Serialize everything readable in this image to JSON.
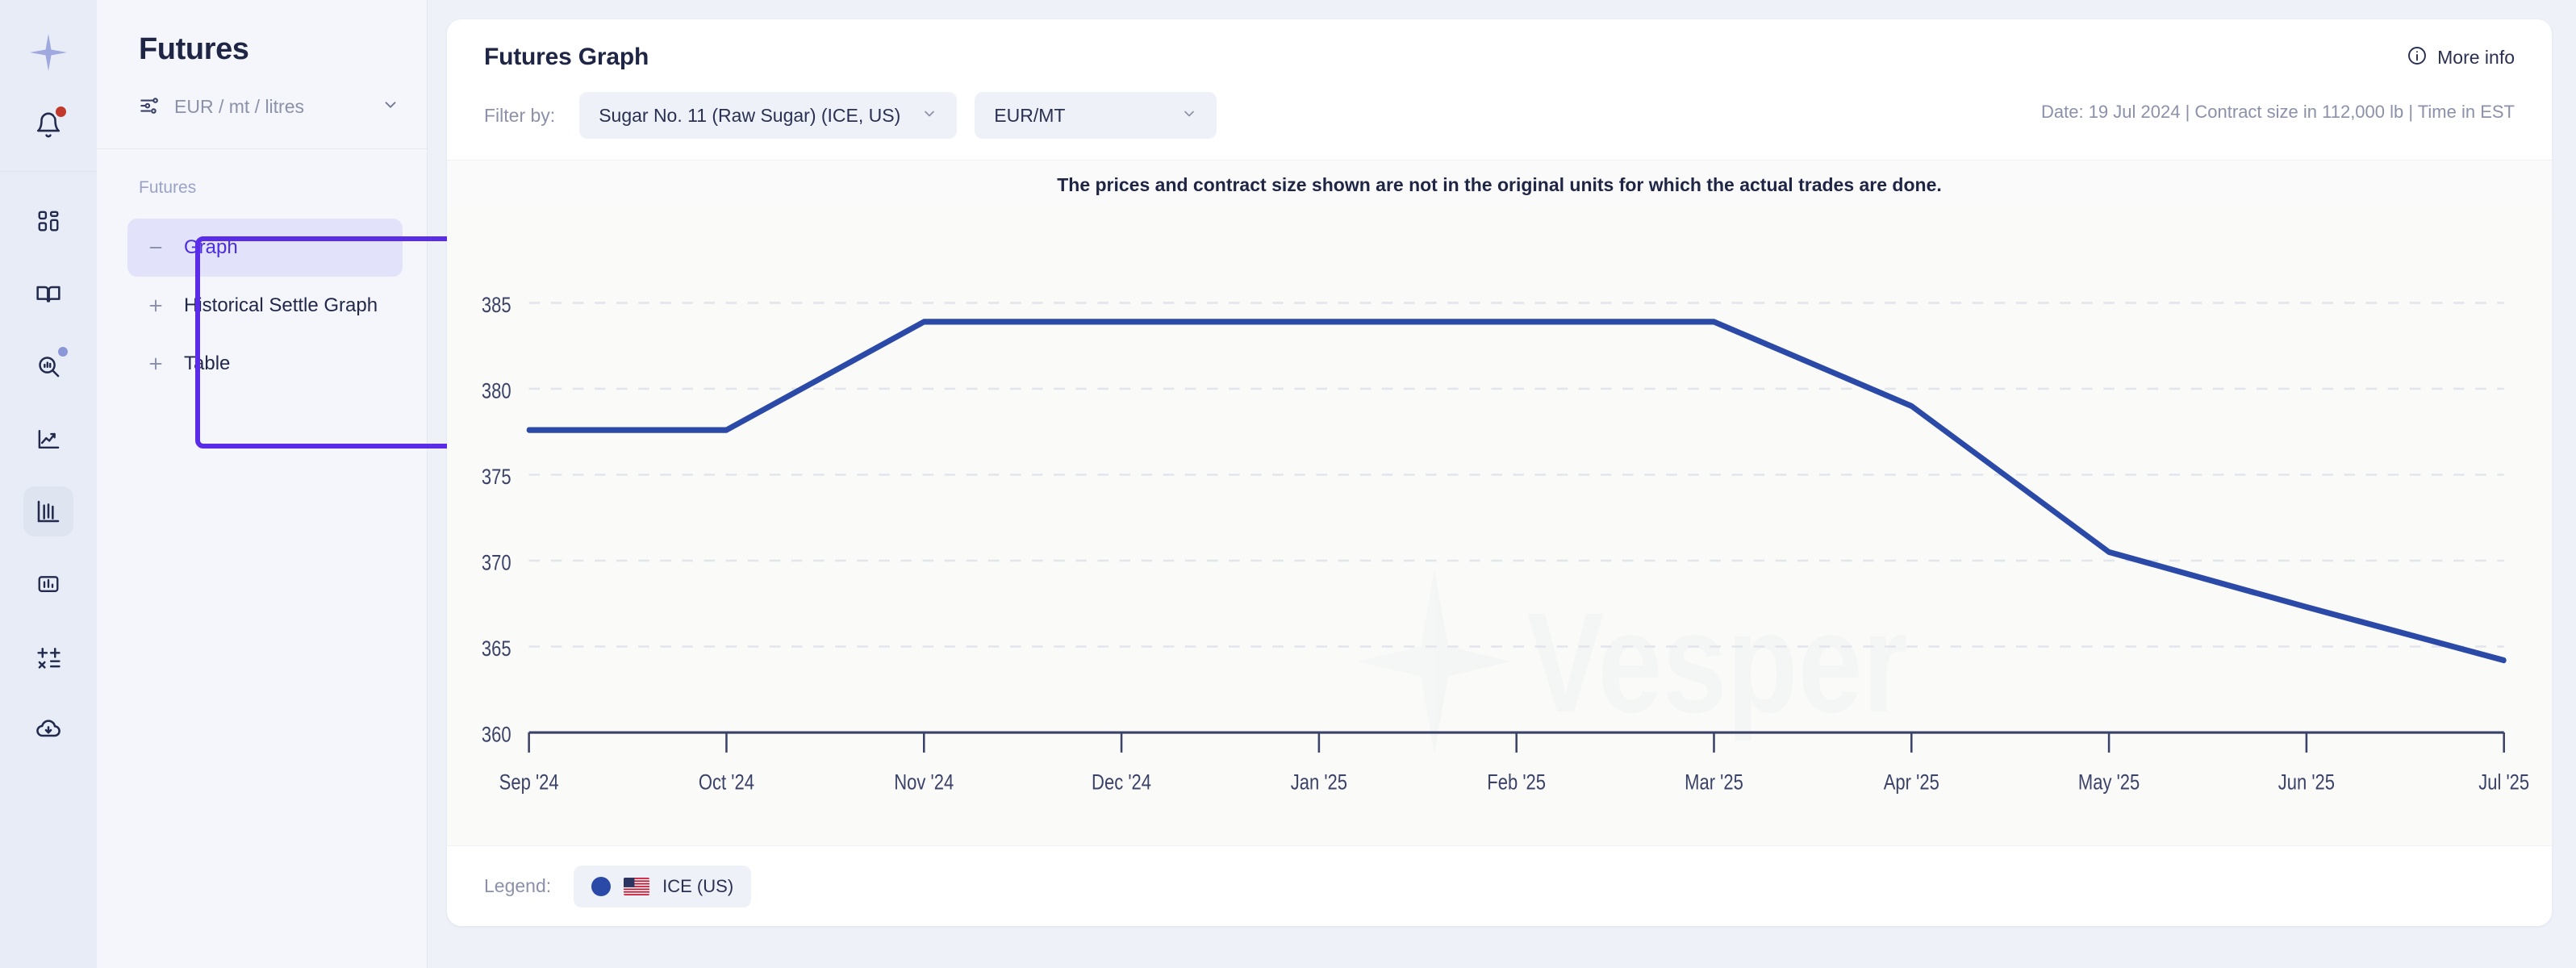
{
  "rail": {
    "logo_icon": "vesper-star-logo",
    "notification_icon": "bell-icon",
    "items": [
      {
        "name": "dashboard-icon",
        "active": false,
        "badge": false
      },
      {
        "name": "book-icon",
        "active": false,
        "badge": false
      },
      {
        "name": "market-research-icon",
        "active": false,
        "badge": true
      },
      {
        "name": "trend-chart-icon",
        "active": false,
        "badge": false
      },
      {
        "name": "futures-candlestick-icon",
        "active": true,
        "badge": false
      },
      {
        "name": "bar-chart-icon",
        "active": false,
        "badge": false
      },
      {
        "name": "calculator-icon",
        "active": false,
        "badge": false
      },
      {
        "name": "cloud-download-icon",
        "active": false,
        "badge": false
      }
    ]
  },
  "sidebar": {
    "title": "Futures",
    "unit_selector": {
      "icon": "sliders-icon",
      "value": "EUR / mt / litres",
      "chevron": "chevron-down-icon"
    },
    "section_label": "Futures",
    "items": [
      {
        "label": "Graph",
        "icon": "minus-icon",
        "selected": true
      },
      {
        "label": "Historical Settle Graph",
        "icon": "plus-icon",
        "selected": false
      },
      {
        "label": "Table",
        "icon": "plus-icon",
        "selected": false
      }
    ]
  },
  "card": {
    "title": "Futures Graph",
    "more_info": {
      "label": "More info",
      "icon": "info-circle-icon"
    },
    "filter_label": "Filter by:",
    "filters": [
      {
        "value": "Sugar No. 11 (Raw Sugar) (ICE, US)",
        "chevron": "chevron-down-icon"
      },
      {
        "value": "EUR/MT",
        "chevron": "chevron-down-icon"
      }
    ],
    "meta": "Date: 19 Jul 2024 | Contract size in 112,000 lb | Time in EST",
    "notice": "The prices and contract size shown are not in the original units for which the actual trades are done.",
    "legend_label": "Legend:",
    "legend_entries": [
      {
        "label": "ICE (US)",
        "color": "#2b4aa8",
        "flag": "us-flag-icon"
      }
    ],
    "watermark": "Vesper"
  },
  "chart_data": {
    "type": "line",
    "title": "Futures Graph",
    "xlabel": "",
    "ylabel": "",
    "grid": true,
    "legend_position": "bottom-left",
    "ylim": [
      360,
      387.5
    ],
    "yticks": [
      360,
      365,
      370,
      375,
      380,
      385
    ],
    "categories": [
      "Sep '24",
      "Oct '24",
      "Nov '24",
      "Dec '24",
      "Jan '25",
      "Feb '25",
      "Mar '25",
      "Apr '25",
      "May '25",
      "Jun '25",
      "Jul '25"
    ],
    "series": [
      {
        "name": "ICE (US)",
        "color": "#2b4aa8",
        "values": [
          377.6,
          377.6,
          383.9,
          383.9,
          383.9,
          383.9,
          383.9,
          379.0,
          370.5,
          367.3,
          364.2
        ]
      }
    ]
  }
}
